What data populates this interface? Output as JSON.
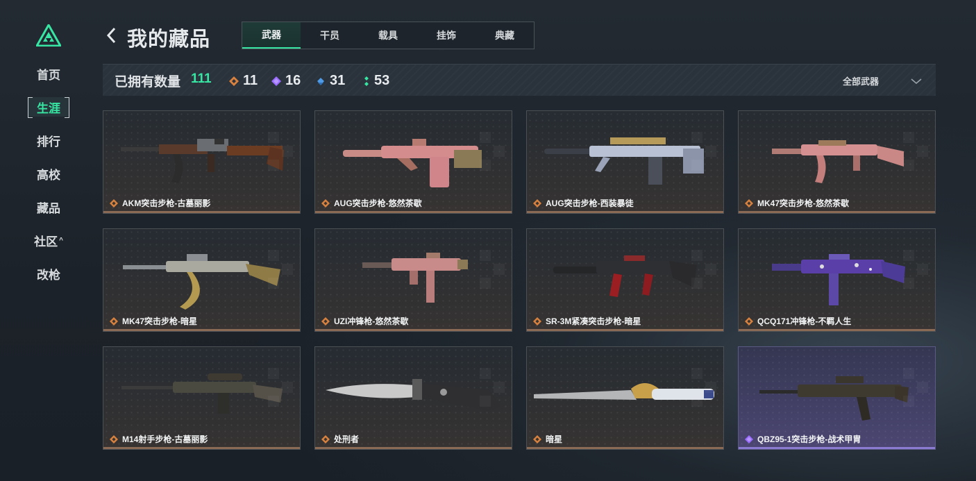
{
  "nav": {
    "items": [
      {
        "label": "首页",
        "active": false
      },
      {
        "label": "生涯",
        "active": true
      },
      {
        "label": "排行",
        "active": false
      },
      {
        "label": "高校",
        "active": false
      },
      {
        "label": "藏品",
        "active": false
      },
      {
        "label": "社区",
        "active": false,
        "caret": "^"
      },
      {
        "label": "改枪",
        "active": false
      }
    ]
  },
  "header": {
    "title": "我的藏品",
    "tabs": [
      {
        "label": "武器",
        "active": true
      },
      {
        "label": "干员",
        "active": false
      },
      {
        "label": "载具",
        "active": false
      },
      {
        "label": "挂饰",
        "active": false
      },
      {
        "label": "典藏",
        "active": false
      }
    ]
  },
  "stats": {
    "owned_label": "已拥有数量",
    "owned_count": "111",
    "rarities": [
      {
        "icon": "orange-diamond-icon",
        "color": "#d9823f",
        "count": "11"
      },
      {
        "icon": "purple-diamond-icon",
        "color": "#9a6bff",
        "count": "16"
      },
      {
        "icon": "blue-diamond-icon",
        "color": "#4f9be8",
        "count": "31"
      },
      {
        "icon": "green-dots-icon",
        "color": "#38e6a4",
        "count": "53"
      }
    ],
    "filter_label": "全部武器"
  },
  "colors": {
    "accent": "#38e6a4",
    "legendary": "#d9823f",
    "epic": "#9a6bff"
  },
  "items": [
    {
      "name": "AKM突击步枪-古墓丽影",
      "rarity": "legendary",
      "icon": "orange-diamond-icon",
      "weapon": "rifle-ak"
    },
    {
      "name": "AUG突击步枪-悠然茶歇",
      "rarity": "legendary",
      "icon": "orange-diamond-icon",
      "weapon": "rifle-aug-pink"
    },
    {
      "name": "AUG突击步枪-西装暴徒",
      "rarity": "legendary",
      "icon": "orange-diamond-icon",
      "weapon": "rifle-aug-silver"
    },
    {
      "name": "MK47突击步枪-悠然茶歇",
      "rarity": "legendary",
      "icon": "orange-diamond-icon",
      "weapon": "rifle-mk47-pink"
    },
    {
      "name": "MK47突击步枪-暗星",
      "rarity": "legendary",
      "icon": "orange-diamond-icon",
      "weapon": "rifle-mk47-gold"
    },
    {
      "name": "UZI冲锋枪-悠然茶歇",
      "rarity": "legendary",
      "icon": "orange-diamond-icon",
      "weapon": "smg-uzi-pink"
    },
    {
      "name": "SR-3M紧凑突击步枪-暗星",
      "rarity": "legendary",
      "icon": "orange-diamond-icon",
      "weapon": "rifle-sr3m-red"
    },
    {
      "name": "QCQ171冲锋枪-不羁人生",
      "rarity": "legendary",
      "icon": "orange-diamond-icon",
      "weapon": "smg-qcq-purple"
    },
    {
      "name": "M14射手步枪-古墓丽影",
      "rarity": "legendary",
      "icon": "orange-diamond-icon",
      "weapon": "rifle-m14"
    },
    {
      "name": "处刑者",
      "rarity": "legendary",
      "icon": "orange-diamond-icon",
      "weapon": "knife-executioner"
    },
    {
      "name": "暗星",
      "rarity": "legendary",
      "icon": "orange-diamond-icon",
      "weapon": "knife-darkstar"
    },
    {
      "name": "QBZ95-1突击步枪-战术甲胄",
      "rarity": "epic",
      "icon": "purple-diamond-icon",
      "weapon": "rifle-qbz95"
    }
  ]
}
